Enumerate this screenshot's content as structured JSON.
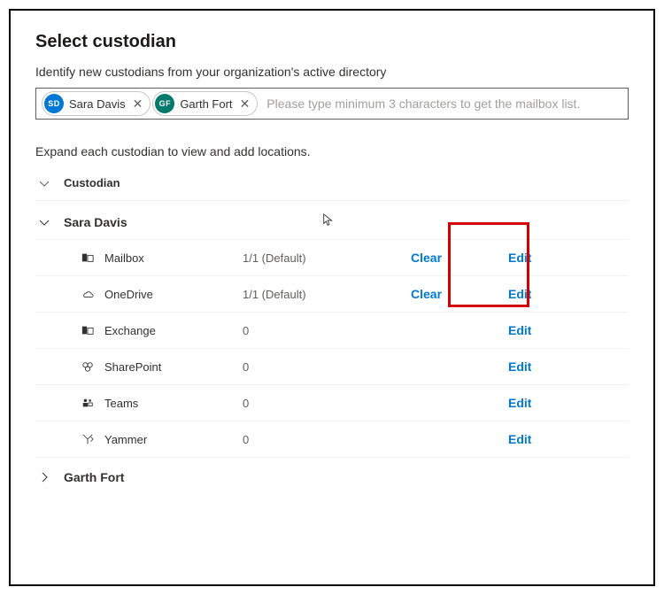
{
  "header": {
    "title": "Select custodian",
    "subtitle": "Identify new custodians from your organization's active directory",
    "expand_hint": "Expand each custodian to view and add locations.",
    "column_header": "Custodian"
  },
  "picker": {
    "chips": [
      {
        "initials": "SD",
        "name": "Sara Davis",
        "color": "blue"
      },
      {
        "initials": "GF",
        "name": "Garth Fort",
        "color": "teal"
      }
    ],
    "placeholder": "Please type minimum 3 characters to get the mailbox list."
  },
  "actions": {
    "clear": "Clear",
    "edit": "Edit"
  },
  "custodians": [
    {
      "name": "Sara Davis",
      "expanded": true,
      "locations": [
        {
          "icon": "mailbox",
          "label": "Mailbox",
          "count": "1/1 (Default)",
          "has_clear": true
        },
        {
          "icon": "onedrive",
          "label": "OneDrive",
          "count": "1/1 (Default)",
          "has_clear": true
        },
        {
          "icon": "exchange",
          "label": "Exchange",
          "count": "0",
          "has_clear": false
        },
        {
          "icon": "sharepoint",
          "label": "SharePoint",
          "count": "0",
          "has_clear": false
        },
        {
          "icon": "teams",
          "label": "Teams",
          "count": "0",
          "has_clear": false
        },
        {
          "icon": "yammer",
          "label": "Yammer",
          "count": "0",
          "has_clear": false
        }
      ]
    },
    {
      "name": "Garth Fort",
      "expanded": false,
      "locations": []
    }
  ]
}
